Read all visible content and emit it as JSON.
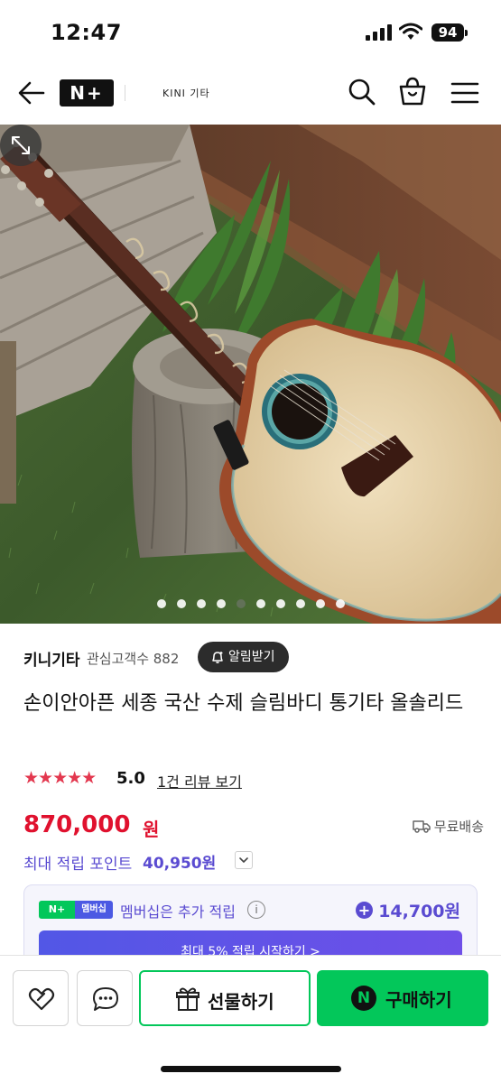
{
  "status_bar": {
    "time": "12:47",
    "battery": "94"
  },
  "header": {
    "logo": "N+",
    "store_name": "KINI 기타"
  },
  "hero": {
    "dot_count": 10,
    "active_dot": 4
  },
  "store": {
    "name": "키니기타",
    "followers": "관심고객수 882",
    "alarm_label": "알림받기"
  },
  "product": {
    "title": "손이안아픈 세종 국산 수제 슬림바디 통기타 올솔리드",
    "stars": "★★★★★",
    "rating": "5.0",
    "review_link": "1건 리뷰 보기",
    "price": "870,000",
    "price_unit": "원",
    "shipping": "무료배송",
    "points_label": "최대 적립 포인트",
    "points_value": "40,950원"
  },
  "membership": {
    "badge_left": "N+",
    "badge_right": "멤버십",
    "text": "멤버십은 추가 적립",
    "info": "i",
    "points": "14,700원",
    "cta": "최대 5% 적립 시작하기 >"
  },
  "bottom_bar": {
    "gift_label": "선물하기",
    "buy_label": "구매하기",
    "n_mark": "N"
  },
  "colors": {
    "accent_green": "#03c75a",
    "price_red": "#e0112e",
    "points_purple": "#5a4bd1"
  },
  "icons": [
    "back-arrow-icon",
    "search-icon",
    "cart-icon",
    "menu-icon",
    "expand-icon",
    "bell-icon",
    "truck-icon",
    "chevron-down-icon",
    "heart-icon",
    "chat-icon",
    "gift-icon"
  ]
}
